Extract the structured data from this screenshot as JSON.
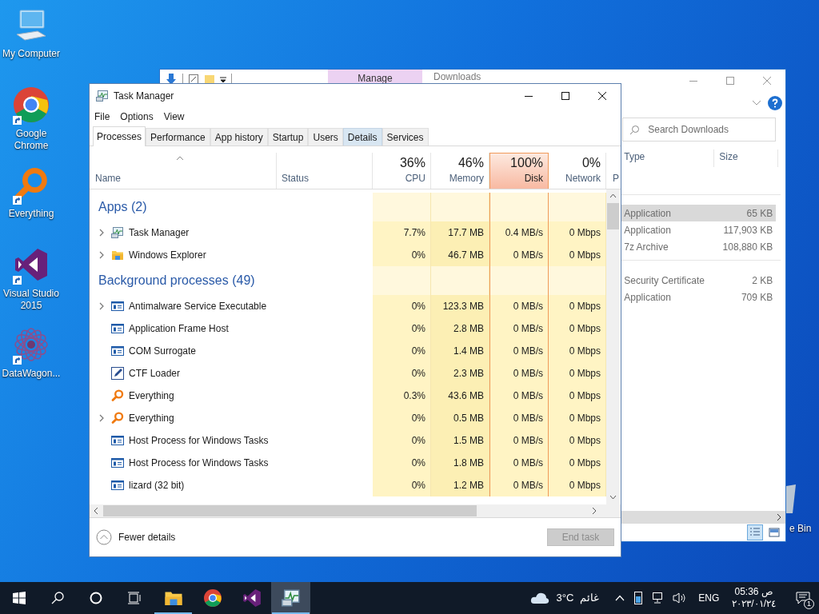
{
  "desktop_icons": [
    {
      "label": "My Computer"
    },
    {
      "label": "Google Chrome"
    },
    {
      "label": "Everything"
    },
    {
      "label": "Visual Studio 2015"
    },
    {
      "label": "DataWagon..."
    }
  ],
  "recycle_bin": {
    "label": "e Bin"
  },
  "explorer": {
    "ribbon_tab": "Manage",
    "title": "Downloads",
    "search": {
      "placeholder": "Search Downloads"
    },
    "columns": [
      "Type",
      "Size"
    ],
    "groups": [
      {
        "files": [
          {
            "type": "Application",
            "size": "65 KB",
            "selected": true
          },
          {
            "type": "Application",
            "size": "117,903 KB",
            "selected": false
          },
          {
            "type": "7z Archive",
            "size": "108,880 KB",
            "selected": false
          }
        ]
      },
      {
        "files": [
          {
            "type": "Security Certificate",
            "size": "2 KB",
            "selected": false
          },
          {
            "type": "Application",
            "size": "709 KB",
            "selected": false
          }
        ]
      }
    ],
    "views": [
      {
        "selected": true
      },
      {
        "selected": false
      }
    ]
  },
  "task_manager": {
    "title": "Task Manager",
    "menu": [
      "File",
      "Options",
      "View"
    ],
    "tabs": [
      {
        "label": "Processes",
        "selected": true,
        "hovered": false
      },
      {
        "label": "Performance",
        "selected": false,
        "hovered": false
      },
      {
        "label": "App history",
        "selected": false,
        "hovered": false
      },
      {
        "label": "Startup",
        "selected": false,
        "hovered": false
      },
      {
        "label": "Users",
        "selected": false,
        "hovered": false
      },
      {
        "label": "Details",
        "selected": false,
        "hovered": true
      },
      {
        "label": "Services",
        "selected": false,
        "hovered": false
      }
    ],
    "columns": [
      {
        "label": "Name"
      },
      {
        "label": "Status"
      },
      {
        "label": "CPU",
        "total": "36%",
        "highlighted": false
      },
      {
        "label": "Memory",
        "total": "46%",
        "highlighted": false
      },
      {
        "label": "Disk",
        "total": "100%",
        "highlighted": true
      },
      {
        "label": "Network",
        "total": "0%",
        "highlighted": false
      },
      {
        "label": "P"
      }
    ],
    "rows": [
      {
        "kind": "group",
        "label": "Apps (2)"
      },
      {
        "kind": "process",
        "name": "Task Manager",
        "expandable": true,
        "values": [
          "7.7%",
          "17.7 MB",
          "0.4 MB/s",
          "0 Mbps"
        ]
      },
      {
        "kind": "process",
        "name": "Windows Explorer",
        "expandable": true,
        "values": [
          "0%",
          "46.7 MB",
          "0 MB/s",
          "0 Mbps"
        ]
      },
      {
        "kind": "group",
        "label": "Background processes (49)"
      },
      {
        "kind": "process",
        "name": "Antimalware Service Executable",
        "expandable": true,
        "values": [
          "0%",
          "123.3 MB",
          "0 MB/s",
          "0 Mbps"
        ]
      },
      {
        "kind": "process",
        "name": "Application Frame Host",
        "expandable": false,
        "values": [
          "0%",
          "2.8 MB",
          "0 MB/s",
          "0 Mbps"
        ]
      },
      {
        "kind": "process",
        "name": "COM Surrogate",
        "expandable": false,
        "values": [
          "0%",
          "1.4 MB",
          "0 MB/s",
          "0 Mbps"
        ]
      },
      {
        "kind": "process",
        "name": "CTF Loader",
        "expandable": false,
        "values": [
          "0%",
          "2.3 MB",
          "0 MB/s",
          "0 Mbps"
        ]
      },
      {
        "kind": "process",
        "name": "Everything",
        "expandable": false,
        "values": [
          "0.3%",
          "43.6 MB",
          "0 MB/s",
          "0 Mbps"
        ]
      },
      {
        "kind": "process",
        "name": "Everything",
        "expandable": true,
        "values": [
          "0%",
          "0.5 MB",
          "0 MB/s",
          "0 Mbps"
        ]
      },
      {
        "kind": "process",
        "name": "Host Process for Windows Tasks",
        "expandable": false,
        "values": [
          "0%",
          "1.5 MB",
          "0 MB/s",
          "0 Mbps"
        ]
      },
      {
        "kind": "process",
        "name": "Host Process for Windows Tasks",
        "expandable": false,
        "values": [
          "0%",
          "1.8 MB",
          "0 MB/s",
          "0 Mbps"
        ]
      },
      {
        "kind": "process",
        "name": "lizard (32 bit)",
        "expandable": false,
        "values": [
          "0%",
          "1.2 MB",
          "0 MB/s",
          "0 Mbps"
        ]
      }
    ],
    "fewer_details": "Fewer details",
    "end_task": {
      "label": "End task",
      "disabled": true
    }
  },
  "taskbar": {
    "apps": [
      {
        "running": true,
        "active": false
      },
      {
        "running": false,
        "active": false
      },
      {
        "running": false,
        "active": false
      },
      {
        "running": true,
        "active": true
      }
    ],
    "temperature": "3°C",
    "weather": "غائم",
    "language": "ENG",
    "time": "05:36 ص",
    "date": "٢٠٢٣/٠١/٢٤",
    "notifications": "1"
  }
}
